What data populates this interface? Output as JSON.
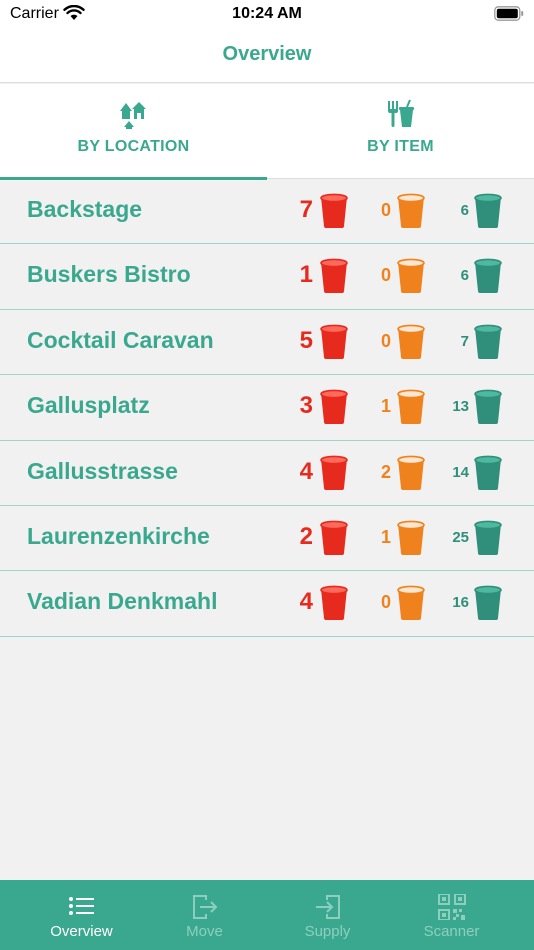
{
  "status_bar": {
    "carrier": "Carrier",
    "time": "10:24 AM"
  },
  "nav": {
    "title": "Overview"
  },
  "segments": [
    {
      "label": "BY LOCATION",
      "icon": "houses-icon",
      "selected": true
    },
    {
      "label": "BY ITEM",
      "icon": "fork-cup-icon",
      "selected": false
    }
  ],
  "colors": {
    "accent": "#3aa88f",
    "red": "#e62b1e",
    "orange": "#f0821e",
    "green": "#2f8f7a"
  },
  "locations": [
    {
      "name": "Backstage",
      "red": "7",
      "orange": "0",
      "green": "6"
    },
    {
      "name": "Buskers Bistro",
      "red": "1",
      "orange": "0",
      "green": "6"
    },
    {
      "name": "Cocktail Caravan",
      "red": "5",
      "orange": "0",
      "green": "7"
    },
    {
      "name": "Gallusplatz",
      "red": "3",
      "orange": "1",
      "green": "13"
    },
    {
      "name": "Gallusstrasse",
      "red": "4",
      "orange": "2",
      "green": "14"
    },
    {
      "name": "Laurenzenkirche",
      "red": "2",
      "orange": "1",
      "green": "25"
    },
    {
      "name": "Vadian Denkmahl",
      "red": "4",
      "orange": "0",
      "green": "16"
    }
  ],
  "tabs": [
    {
      "label": "Overview",
      "icon": "list-icon",
      "active": true
    },
    {
      "label": "Move",
      "icon": "move-out-icon",
      "active": false
    },
    {
      "label": "Supply",
      "icon": "supply-in-icon",
      "active": false
    },
    {
      "label": "Scanner",
      "icon": "qr-code-icon",
      "active": false
    }
  ]
}
